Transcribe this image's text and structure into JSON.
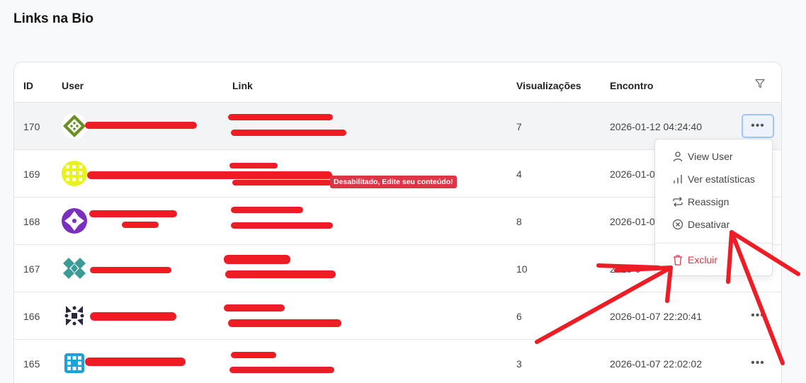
{
  "page": {
    "title": "Links na Bio"
  },
  "table": {
    "headers": {
      "id": "ID",
      "user": "User",
      "link": "Link",
      "views": "Visualizações",
      "date": "Encontro"
    },
    "rows": [
      {
        "id": "170",
        "views": "7",
        "date": "2026-01-12 04:24:40"
      },
      {
        "id": "169",
        "views": "4",
        "date": "2026-01-0"
      },
      {
        "id": "168",
        "views": "8",
        "date": "2026-01-0"
      },
      {
        "id": "167",
        "views": "10",
        "date": "2026-0"
      },
      {
        "id": "166",
        "views": "6",
        "date": "2026-01-07 22:20:41"
      },
      {
        "id": "165",
        "views": "3",
        "date": "2026-01-07 22:02:02"
      }
    ],
    "disabled_badge": "Desabilitado, Edite seu conteúdo!"
  },
  "menu": {
    "items": [
      {
        "label": "View User",
        "icon": "user-icon"
      },
      {
        "label": "Ver estatísticas",
        "icon": "bar-chart-icon"
      },
      {
        "label": "Reassign",
        "icon": "repeat-icon"
      },
      {
        "label": "Desativar",
        "icon": "x-circle-icon"
      },
      {
        "label": "Excluir",
        "icon": "trash-icon"
      }
    ]
  },
  "colors": {
    "danger": "#dc3545",
    "annotation": "#ee1c25",
    "focus": "#9ec5fe"
  }
}
